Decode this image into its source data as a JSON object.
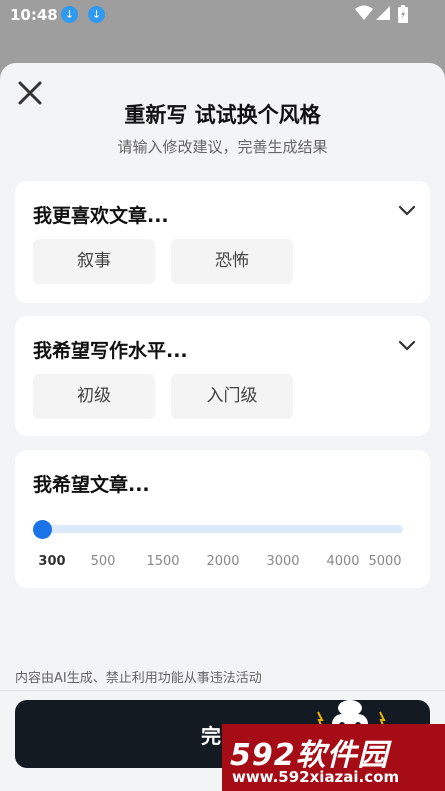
{
  "status_bar": {
    "time": "10:48",
    "icons": [
      "download-icon",
      "download-icon",
      "wifi-icon",
      "signal-icon",
      "battery-icon"
    ]
  },
  "sheet": {
    "title": "重新写 试试换个风格",
    "subtitle": "请输入修改建议，完善生成结果"
  },
  "cards": [
    {
      "title": "我更喜欢文章...",
      "options": [
        "叙事",
        "恐怖"
      ]
    },
    {
      "title": "我希望写作水平...",
      "options": [
        "初级",
        "入门级"
      ]
    },
    {
      "title": "我希望文章...",
      "slider": {
        "value": 300,
        "ticks": [
          "300",
          "500",
          "1500",
          "2000",
          "3000",
          "4000",
          "5000"
        ]
      }
    }
  ],
  "disclaimer": "内容由AI生成、禁止利用功能从事违法活动",
  "done_button": {
    "label": "完"
  },
  "watermark": {
    "brand": "592软件园",
    "url": "www.592xiazai.com"
  },
  "colors": {
    "accent": "#1a73e8",
    "button_bg": "#131a22",
    "watermark_bg": "#a60c16"
  }
}
